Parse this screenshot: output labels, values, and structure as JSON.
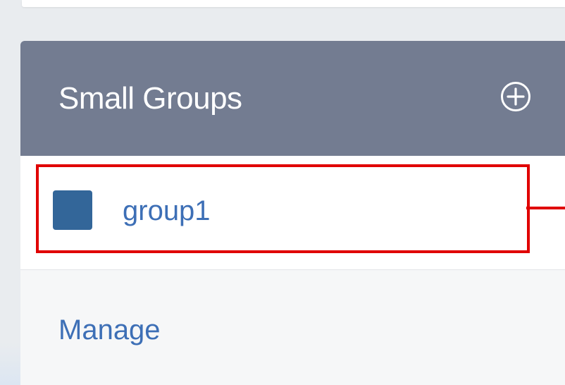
{
  "panel": {
    "title": "Small Groups",
    "add_icon": "plus-circle-icon",
    "header_color": "#737c91"
  },
  "groups": [
    {
      "name": "group1",
      "color": "#336699",
      "highlighted": true
    }
  ],
  "manage": {
    "label": "Manage"
  },
  "annotation": {
    "color": "#e00000"
  }
}
